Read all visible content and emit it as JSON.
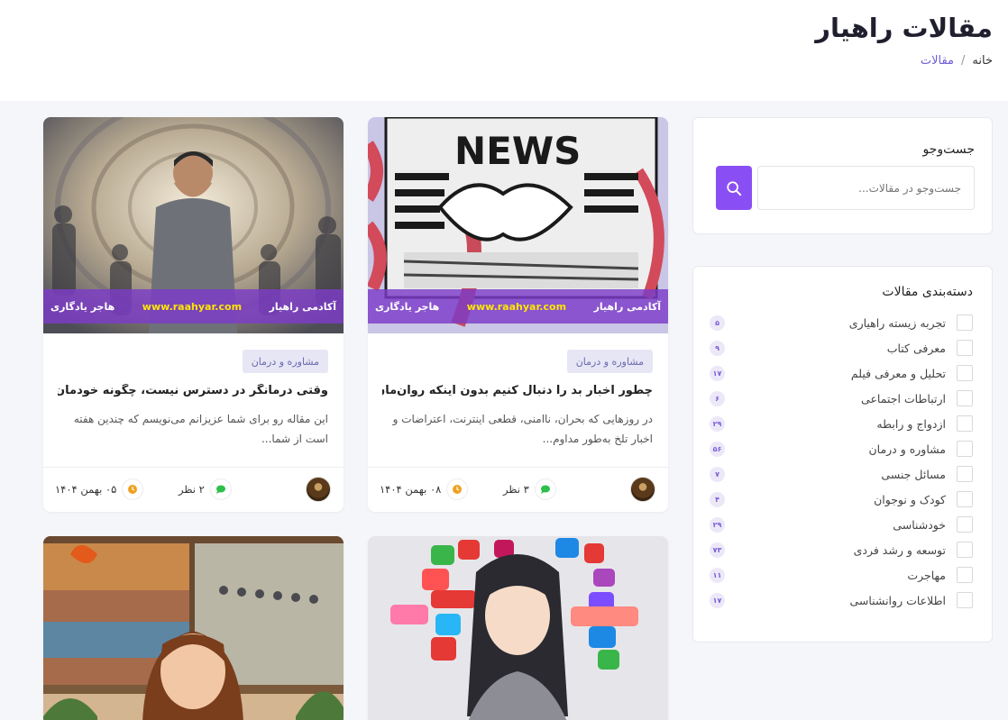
{
  "header": {
    "title": "مقالات راهیار",
    "breadcrumb": {
      "home": "خانه",
      "separator": "/",
      "current": "مقالات"
    }
  },
  "search": {
    "label": "جست‌وجو",
    "placeholder": "جست‌وجو در مقالات...",
    "icon": "search-icon"
  },
  "categories": {
    "title": "دسته‌بندی مقالات",
    "items": [
      {
        "label": "تجربه زیسته راهیاری",
        "count": "۵"
      },
      {
        "label": "معرفی کتاب",
        "count": "۹"
      },
      {
        "label": "تحلیل و معرفی فیلم",
        "count": "۱۷"
      },
      {
        "label": "ارتباطات اجتماعی",
        "count": "۶"
      },
      {
        "label": "ازدواج و رابطه",
        "count": "۲۹"
      },
      {
        "label": "مشاوره و درمان",
        "count": "۵۶"
      },
      {
        "label": "مسائل جنسی",
        "count": "۷"
      },
      {
        "label": "کودک و نوجوان",
        "count": "۴"
      },
      {
        "label": "خودشناسی",
        "count": "۲۹"
      },
      {
        "label": "توسعه و رشد فردی",
        "count": "۷۳"
      },
      {
        "label": "مهاجرت",
        "count": "۱۱"
      },
      {
        "label": "اطلاعات روانشناسی",
        "count": "۱۷"
      }
    ]
  },
  "watermark": {
    "academy": "آکادمی راهیار",
    "url": "www.raahyar.com",
    "author": "هاجر یادگاری"
  },
  "cards": [
    {
      "category": "مشاوره و درمان",
      "title": "چطور اخبار بد را دنبال کنیم بدون اینکه روان‌مان فرو...",
      "excerpt": "در روزهایی که بحران، ناامنی، قطعی اینترنت، اعتراضات و اخبار تلخ به‌طور مداوم...",
      "comments": "۳ نظر",
      "date": "۰۸ بهمن ۱۴۰۴",
      "image_text": "NEWS"
    },
    {
      "category": "مشاوره و درمان",
      "title": "وقتی درمانگر در دسترس نیست، چگونه خودمان را آ...",
      "excerpt": "این مقاله رو برای شما عزیزانم می‌نویسم که چندین هفته است از شما...",
      "comments": "۲ نظر",
      "date": "۰۵ بهمن ۱۴۰۴"
    }
  ],
  "colors": {
    "accent": "#8a4ff4",
    "chip_bg": "#e6e6f5",
    "watermark_bg": "#7d3cc8",
    "url_yellow": "#ffe600",
    "comment_green": "#2ec04a",
    "clock_orange": "#f0a020"
  }
}
